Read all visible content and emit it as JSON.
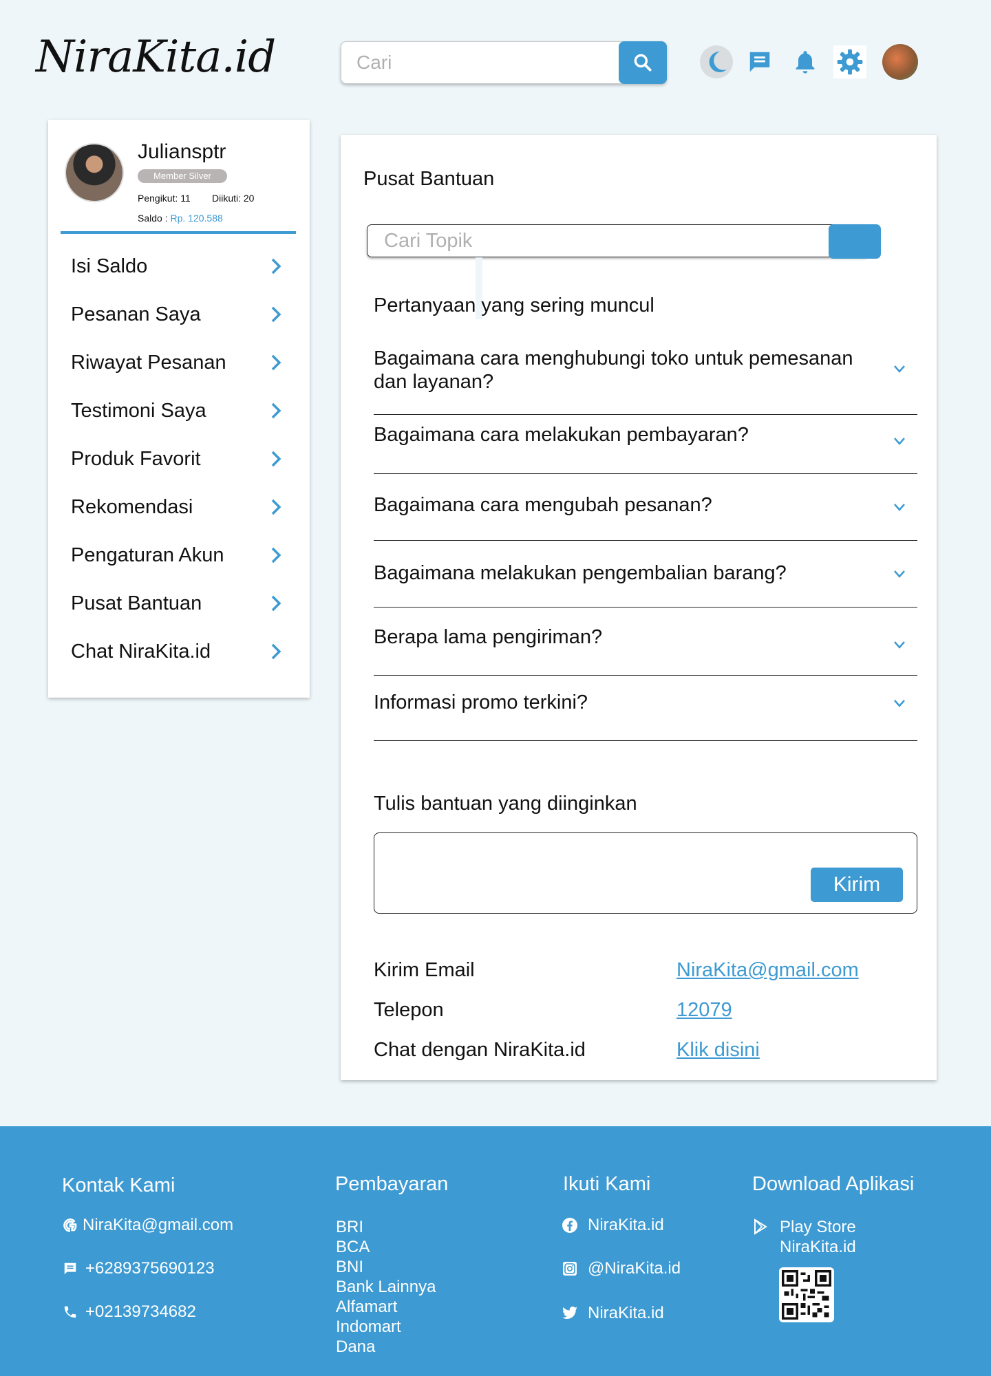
{
  "header": {
    "logo": "NiraKita.id",
    "search_placeholder": "Cari"
  },
  "profile": {
    "name": "Juliansptr",
    "badge": "Member Silver",
    "followers": "Pengikut: 11",
    "following": "Diikuti: 20",
    "saldo_label": "Saldo : ",
    "saldo_value": "Rp. 120.588"
  },
  "sidebar": {
    "items": [
      {
        "label": "Isi Saldo"
      },
      {
        "label": "Pesanan Saya"
      },
      {
        "label": "Riwayat Pesanan"
      },
      {
        "label": "Testimoni Saya"
      },
      {
        "label": "Produk Favorit"
      },
      {
        "label": "Rekomendasi"
      },
      {
        "label": "Pengaturan Akun"
      },
      {
        "label": "Pusat Bantuan"
      },
      {
        "label": "Chat NiraKita.id"
      }
    ]
  },
  "main": {
    "title": "Pusat Bantuan",
    "topic_placeholder": "Cari Topik",
    "faq_heading": "Pertanyaan yang sering muncul",
    "faqs": [
      {
        "q": "Bagaimana cara menghubungi toko untuk pemesanan dan layanan?"
      },
      {
        "q": "Bagaimana cara melakukan pembayaran?"
      },
      {
        "q": "Bagaimana cara mengubah pesanan?"
      },
      {
        "q": "Bagaimana melakukan pengembalian barang?"
      },
      {
        "q": "Berapa lama pengiriman?"
      },
      {
        "q": "Informasi promo terkini?"
      }
    ],
    "help_label": "Tulis bantuan yang diinginkan",
    "send_label": "Kirim",
    "contacts": [
      {
        "label": "Kirim Email",
        "value": "NiraKita@gmail.com"
      },
      {
        "label": "Telepon",
        "value": "12079"
      },
      {
        "label": "Chat dengan NiraKita.id",
        "value": "Klik disini"
      }
    ]
  },
  "footer": {
    "contact_title": "Kontak Kami",
    "contact_email": "NiraKita@gmail.com",
    "contact_phone1": "+6289375690123",
    "contact_phone2": "+02139734682",
    "payment_title": "Pembayaran",
    "payments": [
      "BRI",
      "BCA",
      "BNI",
      "Bank Lainnya",
      "Alfamart",
      "Indomart",
      "Dana"
    ],
    "follow_title": "Ikuti Kami",
    "facebook": "NiraKita.id",
    "instagram": "@NiraKita.id",
    "twitter": "NiraKita.id",
    "download_title": "Download Aplikasi",
    "play_store": "Play Store",
    "play_store_app": "NiraKita.id"
  },
  "colors": {
    "accent": "#3d9ad2",
    "background": "#eef6f9"
  }
}
